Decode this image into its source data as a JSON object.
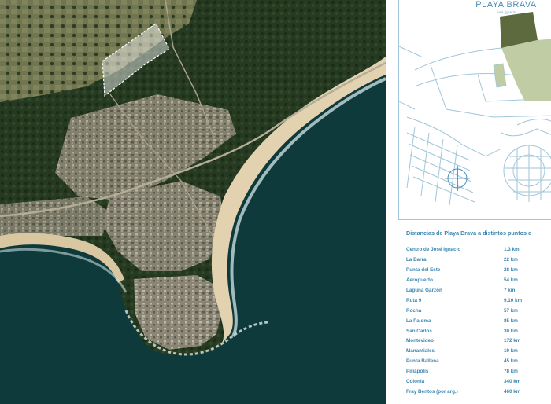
{
  "aerial": {
    "colors": {
      "ocean": "#0f3a3c",
      "beach": "#e2d2b0",
      "surf": "#c7dcdc",
      "forest": "#24361f",
      "town": "#7e7a6c",
      "field": "#6f7452"
    }
  },
  "plan": {
    "logo_name": "PLAYA BRAVA",
    "logo_sub": "José Ignacio",
    "colors": {
      "line": "#9fc6da",
      "lot_dark": "#5d6a3e",
      "lot_light": "#bfcca4"
    }
  },
  "distances": {
    "title": "Distancias de Playa Brava a distintos puntos e",
    "items": [
      {
        "place": "Centro de José Ignacio",
        "km": "1.3 km"
      },
      {
        "place": "La Barra",
        "km": "22 km"
      },
      {
        "place": "Punta del Este",
        "km": "28 km"
      },
      {
        "place": "Aeropuerto",
        "km": "54 km"
      },
      {
        "place": "Laguna Garzón",
        "km": "7 km"
      },
      {
        "place": "Ruta 9",
        "km": "9.10 km"
      },
      {
        "place": "Rocha",
        "km": "57 km"
      },
      {
        "place": "La Paloma",
        "km": "85 km"
      },
      {
        "place": "San Carlos",
        "km": "30 km"
      },
      {
        "place": "Montevideo",
        "km": "172 km"
      },
      {
        "place": "Manantiales",
        "km": "19 km"
      },
      {
        "place": "Punta Ballena",
        "km": "45 km"
      },
      {
        "place": "Piriápolis",
        "km": "78 km"
      },
      {
        "place": "Colonia",
        "km": "340 km"
      },
      {
        "place": "Fray Bentos (por arg.)",
        "km": "460 km"
      }
    ]
  }
}
